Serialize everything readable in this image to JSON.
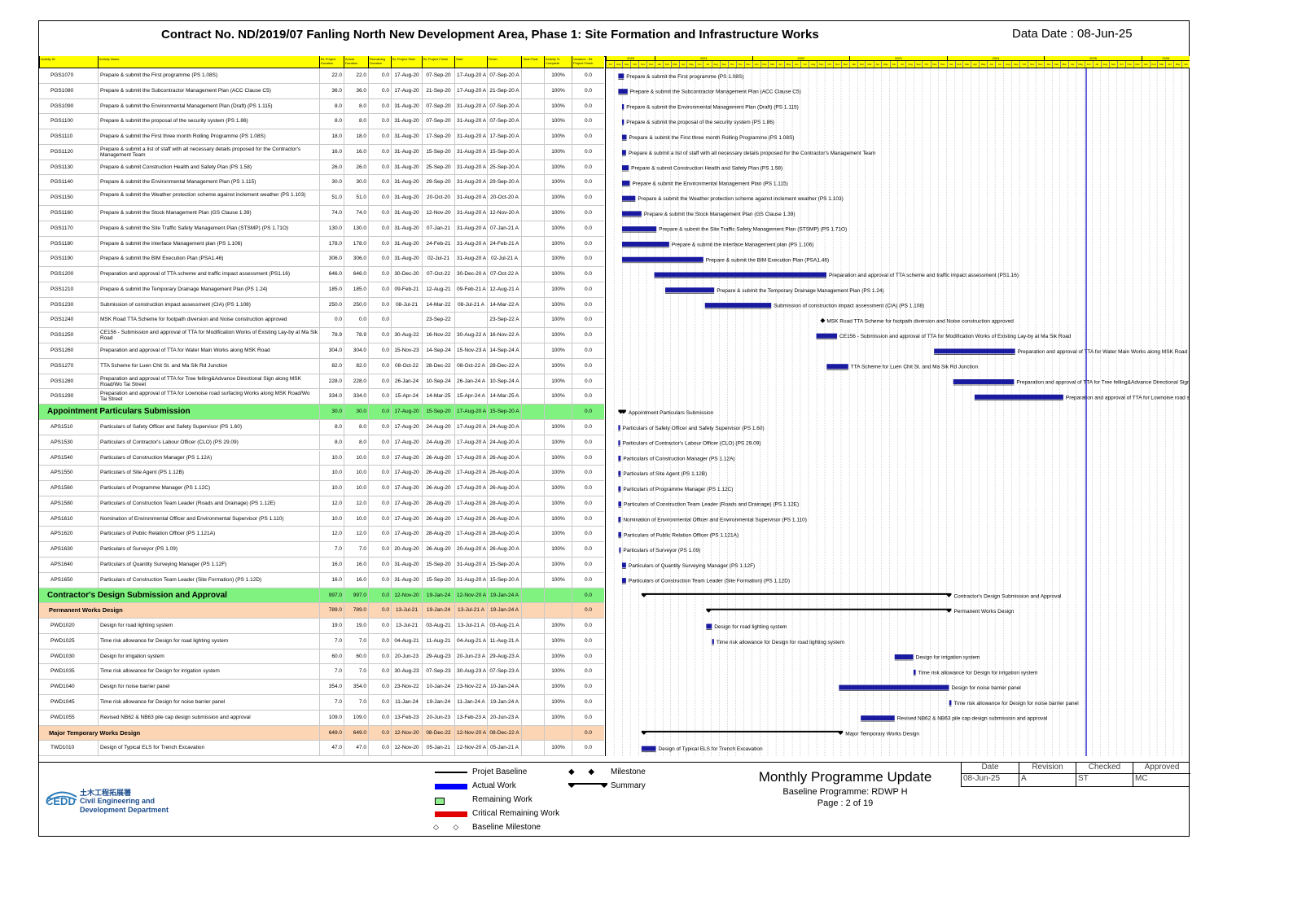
{
  "header": {
    "title": "Contract No. ND/2019/07 Fanling North New Development Area, Phase 1: Site Formation and Infrastructure Works",
    "data_date": "Data Date : 08-Jun-25"
  },
  "columns": [
    "Activity ID",
    "Activity Name",
    "BL Project Duration",
    "Actual Duration",
    "Remaining Duration",
    "BL Project Start",
    "BL Project Finish",
    "Start",
    "Finish",
    "Total Float",
    "Activity % Complete",
    "Variance - BL Project Finish"
  ],
  "timeline": {
    "years": [
      "2020",
      "2021",
      "2022",
      "2023",
      "2024",
      "2025",
      "2026"
    ],
    "months": [
      "Jul",
      "Aug",
      "Sep",
      "Oct",
      "Nov",
      "Dec",
      "Jan",
      "Feb",
      "Mar",
      "Apr",
      "May",
      "Jun"
    ],
    "range_start": "2020-07-01",
    "range_end": "2026-07-01",
    "data_date": "2025-06-08"
  },
  "rows": [
    {
      "type": "task",
      "id": "PGS1070",
      "name": "Prepare & submit the First programme (PS 1.08S)",
      "bl_dur": "22.0",
      "act_dur": "22.0",
      "rem": "0.0",
      "bl_start": "17-Aug-20",
      "bl_finish": "07-Sep-20",
      "start": "17-Aug-20 A",
      "finish": "07-Sep-20 A",
      "tf": "",
      "pct": "100%",
      "var": "0.0"
    },
    {
      "type": "task",
      "id": "PGS1080",
      "name": "Prepare & submit the Subcontractor Management Plan (ACC Clause C5)",
      "bl_dur": "36.0",
      "act_dur": "36.0",
      "rem": "0.0",
      "bl_start": "17-Aug-20",
      "bl_finish": "21-Sep-20",
      "start": "17-Aug-20 A",
      "finish": "21-Sep-20 A",
      "tf": "",
      "pct": "100%",
      "var": "0.0"
    },
    {
      "type": "task",
      "id": "PGS1090",
      "name": "Prepare & submit the Environmental Management Plan (Draft) (PS 1.115)",
      "bl_dur": "8.0",
      "act_dur": "8.0",
      "rem": "0.0",
      "bl_start": "31-Aug-20",
      "bl_finish": "07-Sep-20",
      "start": "31-Aug-20 A",
      "finish": "07-Sep-20 A",
      "tf": "",
      "pct": "100%",
      "var": "0.0"
    },
    {
      "type": "task",
      "id": "PGS1100",
      "name": "Prepare & submit the proposal of the security system (PS 1.86)",
      "bl_dur": "8.0",
      "act_dur": "8.0",
      "rem": "0.0",
      "bl_start": "31-Aug-20",
      "bl_finish": "07-Sep-20",
      "start": "31-Aug-20 A",
      "finish": "07-Sep-20 A",
      "tf": "",
      "pct": "100%",
      "var": "0.0"
    },
    {
      "type": "task",
      "id": "PGS1110",
      "name": "Prepare & submit the First three month Rolling Programme (PS 1.08S)",
      "bl_dur": "18.0",
      "act_dur": "18.0",
      "rem": "0.0",
      "bl_start": "31-Aug-20",
      "bl_finish": "17-Sep-20",
      "start": "31-Aug-20 A",
      "finish": "17-Sep-20 A",
      "tf": "",
      "pct": "100%",
      "var": "0.0"
    },
    {
      "type": "task",
      "id": "PGS1120",
      "name": "Prepare & submit a list of staff with all necessary details proposed for the Contractor's Management Team",
      "bl_dur": "16.0",
      "act_dur": "16.0",
      "rem": "0.0",
      "bl_start": "31-Aug-20",
      "bl_finish": "15-Sep-20",
      "start": "31-Aug-20 A",
      "finish": "15-Sep-20 A",
      "tf": "",
      "pct": "100%",
      "var": "0.0"
    },
    {
      "type": "task",
      "id": "PGS1130",
      "name": "Prepare & submit Construction Health and Safety Plan (PS 1.58)",
      "bl_dur": "26.0",
      "act_dur": "26.0",
      "rem": "0.0",
      "bl_start": "31-Aug-20",
      "bl_finish": "25-Sep-20",
      "start": "31-Aug-20 A",
      "finish": "25-Sep-20 A",
      "tf": "",
      "pct": "100%",
      "var": "0.0"
    },
    {
      "type": "task",
      "id": "PGS1140",
      "name": "Prepare & submit the Environmental Management Plan (PS 1.115)",
      "bl_dur": "30.0",
      "act_dur": "30.0",
      "rem": "0.0",
      "bl_start": "31-Aug-20",
      "bl_finish": "29-Sep-20",
      "start": "31-Aug-20 A",
      "finish": "29-Sep-20 A",
      "tf": "",
      "pct": "100%",
      "var": "0.0"
    },
    {
      "type": "task",
      "id": "PGS1150",
      "name": "Prepare & submit the Weather protection scheme against inclement weather (PS 1.103)",
      "bl_dur": "51.0",
      "act_dur": "51.0",
      "rem": "0.0",
      "bl_start": "31-Aug-20",
      "bl_finish": "20-Oct-20",
      "start": "31-Aug-20 A",
      "finish": "20-Oct-20 A",
      "tf": "",
      "pct": "100%",
      "var": "0.0"
    },
    {
      "type": "task",
      "id": "PGS1160",
      "name": "Prepare & submit the Stock Management Plan (GS Clause 1.39)",
      "bl_dur": "74.0",
      "act_dur": "74.0",
      "rem": "0.0",
      "bl_start": "31-Aug-20",
      "bl_finish": "12-Nov-20",
      "start": "31-Aug-20 A",
      "finish": "12-Nov-20 A",
      "tf": "",
      "pct": "100%",
      "var": "0.0"
    },
    {
      "type": "task",
      "id": "PGS1170",
      "name": "Prepare & submit the Site Traffic Safety Management Plan (STSMP) (PS 1.71O)",
      "bl_dur": "130.0",
      "act_dur": "130.0",
      "rem": "0.0",
      "bl_start": "31-Aug-20",
      "bl_finish": "07-Jan-21",
      "start": "31-Aug-20 A",
      "finish": "07-Jan-21 A",
      "tf": "",
      "pct": "100%",
      "var": "0.0"
    },
    {
      "type": "task",
      "id": "PGS1180",
      "name": "Prepare & submit the interface Management plan (PS 1.106)",
      "bl_dur": "178.0",
      "act_dur": "178.0",
      "rem": "0.0",
      "bl_start": "31-Aug-20",
      "bl_finish": "24-Feb-21",
      "start": "31-Aug-20 A",
      "finish": "24-Feb-21 A",
      "tf": "",
      "pct": "100%",
      "var": "0.0"
    },
    {
      "type": "task",
      "id": "PGS1190",
      "name": "Prepare & submit the BIM Execution Plan (PSA1.46)",
      "bl_dur": "306.0",
      "act_dur": "306.0",
      "rem": "0.0",
      "bl_start": "31-Aug-20",
      "bl_finish": "02-Jul-21",
      "start": "31-Aug-20 A",
      "finish": "02-Jul-21 A",
      "tf": "",
      "pct": "100%",
      "var": "0.0"
    },
    {
      "type": "task",
      "id": "PGS1200",
      "name": "Preparation and approval of TTA scheme and traffic impact assessment (PS1.16)",
      "bl_dur": "646.0",
      "act_dur": "646.0",
      "rem": "0.0",
      "bl_start": "30-Dec-20",
      "bl_finish": "07-Oct-22",
      "start": "30-Dec-20 A",
      "finish": "07-Oct-22 A",
      "tf": "",
      "pct": "100%",
      "var": "0.0"
    },
    {
      "type": "task",
      "id": "PGS1210",
      "name": "Prepare & submit the Temporary Drainage Management Plan (PS 1.24)",
      "bl_dur": "185.0",
      "act_dur": "185.0",
      "rem": "0.0",
      "bl_start": "09-Feb-21",
      "bl_finish": "12-Aug-21",
      "start": "09-Feb-21 A",
      "finish": "12-Aug-21 A",
      "tf": "",
      "pct": "100%",
      "var": "0.0"
    },
    {
      "type": "task",
      "id": "PGS1230",
      "name": "Submission of construction impact assessment (CIA) (PS 1.108)",
      "bl_dur": "250.0",
      "act_dur": "250.0",
      "rem": "0.0",
      "bl_start": "08-Jul-21",
      "bl_finish": "14-Mar-22",
      "start": "08-Jul-21 A",
      "finish": "14-Mar-22 A",
      "tf": "",
      "pct": "100%",
      "var": "0.0"
    },
    {
      "type": "milestone",
      "id": "PGS1240",
      "name": "MSK Road TTA Scheme for footpath diversion and Noise construction approved",
      "bl_dur": "0.0",
      "act_dur": "0.0",
      "rem": "0.0",
      "bl_start": "",
      "bl_finish": "23-Sep-22",
      "start": "",
      "finish": "23-Sep-22 A",
      "tf": "",
      "pct": "100%",
      "var": "0.0"
    },
    {
      "type": "task",
      "id": "PGS1250",
      "name": "CE156 - Submission and approval of TTA for Modification Works of Existing Lay-by at Ma Sik Road",
      "bl_dur": "78.9",
      "act_dur": "78.9",
      "rem": "0.0",
      "bl_start": "30-Aug-22",
      "bl_finish": "16-Nov-22",
      "start": "30-Aug-22 A",
      "finish": "16-Nov-22 A",
      "tf": "",
      "pct": "100%",
      "var": "0.0"
    },
    {
      "type": "task",
      "id": "PGS1260",
      "name": "Preparation and approval of TTA for Water Main Works along MSK Road",
      "bl_dur": "304.0",
      "act_dur": "304.0",
      "rem": "0.0",
      "bl_start": "15-Nov-23",
      "bl_finish": "14-Sep-24",
      "start": "15-Nov-23 A",
      "finish": "14-Sep-24 A",
      "tf": "",
      "pct": "100%",
      "var": "0.0"
    },
    {
      "type": "task",
      "id": "PGS1270",
      "name": "TTA Scheme for Luen Chit St. and Ma Sik Rd Junction",
      "bl_dur": "82.0",
      "act_dur": "82.0",
      "rem": "0.0",
      "bl_start": "08-Oct-22",
      "bl_finish": "28-Dec-22",
      "start": "08-Oct-22 A",
      "finish": "28-Dec-22 A",
      "tf": "",
      "pct": "100%",
      "var": "0.0"
    },
    {
      "type": "task",
      "id": "PGS1280",
      "name": "Preparation and approval of TTA for Tree felling&Advance Directional Sign along MSK Road/Wo Tai Street",
      "bl_dur": "228.0",
      "act_dur": "228.0",
      "rem": "0.0",
      "bl_start": "26-Jan-24",
      "bl_finish": "10-Sep-24",
      "start": "26-Jan-24 A",
      "finish": "10-Sep-24 A",
      "tf": "",
      "pct": "100%",
      "var": "0.0"
    },
    {
      "type": "task",
      "id": "PGS1290",
      "name": "Preparation and approval of TTA for Lownoise road surfacing Works along MSK Road/Wo Tai Street",
      "bl_dur": "334.0",
      "act_dur": "334.0",
      "rem": "0.0",
      "bl_start": "15-Apr-24",
      "bl_finish": "14-Mar-25",
      "start": "15-Apr-24 A",
      "finish": "14-Mar-25 A",
      "tf": "",
      "pct": "100%",
      "var": "0.0"
    },
    {
      "type": "wbs1",
      "id": "",
      "name": "Appointment Particulars Submission",
      "bl_dur": "30.0",
      "act_dur": "30.0",
      "rem": "0.0",
      "bl_start": "17-Aug-20",
      "bl_finish": "15-Sep-20",
      "start": "17-Aug-20 A",
      "finish": "15-Sep-20 A",
      "tf": "",
      "pct": "",
      "var": "0.0"
    },
    {
      "type": "task",
      "id": "APS1510",
      "name": "Particulars of Safety Officer and Safety Supervisor (PS 1.60)",
      "bl_dur": "8.0",
      "act_dur": "8.0",
      "rem": "0.0",
      "bl_start": "17-Aug-20",
      "bl_finish": "24-Aug-20",
      "start": "17-Aug-20 A",
      "finish": "24-Aug-20 A",
      "tf": "",
      "pct": "100%",
      "var": "0.0"
    },
    {
      "type": "task",
      "id": "APS1530",
      "name": "Particulars of Contractor's Labour Officer (CLO) (PS 29.09)",
      "bl_dur": "8.0",
      "act_dur": "8.0",
      "rem": "0.0",
      "bl_start": "17-Aug-20",
      "bl_finish": "24-Aug-20",
      "start": "17-Aug-20 A",
      "finish": "24-Aug-20 A",
      "tf": "",
      "pct": "100%",
      "var": "0.0"
    },
    {
      "type": "task",
      "id": "APS1540",
      "name": "Particulars of Construction Manager (PS 1.12A)",
      "bl_dur": "10.0",
      "act_dur": "10.0",
      "rem": "0.0",
      "bl_start": "17-Aug-20",
      "bl_finish": "26-Aug-20",
      "start": "17-Aug-20 A",
      "finish": "26-Aug-20 A",
      "tf": "",
      "pct": "100%",
      "var": "0.0"
    },
    {
      "type": "task",
      "id": "APS1550",
      "name": "Particulars of Site Agent (PS 1.12B)",
      "bl_dur": "10.0",
      "act_dur": "10.0",
      "rem": "0.0",
      "bl_start": "17-Aug-20",
      "bl_finish": "26-Aug-20",
      "start": "17-Aug-20 A",
      "finish": "26-Aug-20 A",
      "tf": "",
      "pct": "100%",
      "var": "0.0"
    },
    {
      "type": "task",
      "id": "APS1560",
      "name": "Particulars of Programme Manager (PS 1.12C)",
      "bl_dur": "10.0",
      "act_dur": "10.0",
      "rem": "0.0",
      "bl_start": "17-Aug-20",
      "bl_finish": "26-Aug-20",
      "start": "17-Aug-20 A",
      "finish": "26-Aug-20 A",
      "tf": "",
      "pct": "100%",
      "var": "0.0"
    },
    {
      "type": "task",
      "id": "APS1580",
      "name": "Particulars of Construction Team Leader (Roads and Drainage) (PS 1.12E)",
      "bl_dur": "12.0",
      "act_dur": "12.0",
      "rem": "0.0",
      "bl_start": "17-Aug-20",
      "bl_finish": "28-Aug-20",
      "start": "17-Aug-20 A",
      "finish": "28-Aug-20 A",
      "tf": "",
      "pct": "100%",
      "var": "0.0"
    },
    {
      "type": "task",
      "id": "APS1610",
      "name": "Nomination of Environmental Officer and Environmental Supervisor (PS 1.110)",
      "bl_dur": "10.0",
      "act_dur": "10.0",
      "rem": "0.0",
      "bl_start": "17-Aug-20",
      "bl_finish": "26-Aug-20",
      "start": "17-Aug-20 A",
      "finish": "26-Aug-20 A",
      "tf": "",
      "pct": "100%",
      "var": "0.0"
    },
    {
      "type": "task",
      "id": "APS1620",
      "name": "Particulars of Public Relation Officer (PS 1.121A)",
      "bl_dur": "12.0",
      "act_dur": "12.0",
      "rem": "0.0",
      "bl_start": "17-Aug-20",
      "bl_finish": "28-Aug-20",
      "start": "17-Aug-20 A",
      "finish": "28-Aug-20 A",
      "tf": "",
      "pct": "100%",
      "var": "0.0"
    },
    {
      "type": "task",
      "id": "APS1630",
      "name": "Particulars of Surveyor (PS 1.09)",
      "bl_dur": "7.0",
      "act_dur": "7.0",
      "rem": "0.0",
      "bl_start": "20-Aug-20",
      "bl_finish": "26-Aug-20",
      "start": "20-Aug-20 A",
      "finish": "26-Aug-20 A",
      "tf": "",
      "pct": "100%",
      "var": "0.0"
    },
    {
      "type": "task",
      "id": "APS1640",
      "name": "Particulars of Quantity Surveying Manager (PS 1.12F)",
      "bl_dur": "16.0",
      "act_dur": "16.0",
      "rem": "0.0",
      "bl_start": "31-Aug-20",
      "bl_finish": "15-Sep-20",
      "start": "31-Aug-20 A",
      "finish": "15-Sep-20 A",
      "tf": "",
      "pct": "100%",
      "var": "0.0"
    },
    {
      "type": "task",
      "id": "APS1650",
      "name": "Particulars of Construction Team Leader (Site Formation) (PS 1.12D)",
      "bl_dur": "16.0",
      "act_dur": "16.0",
      "rem": "0.0",
      "bl_start": "31-Aug-20",
      "bl_finish": "15-Sep-20",
      "start": "31-Aug-20 A",
      "finish": "15-Sep-20 A",
      "tf": "",
      "pct": "100%",
      "var": "0.0"
    },
    {
      "type": "wbs1",
      "id": "",
      "name": "Contractor's Design Submission and Approval",
      "bl_dur": "997.0",
      "act_dur": "997.0",
      "rem": "0.0",
      "bl_start": "12-Nov-20",
      "bl_finish": "19-Jan-24",
      "start": "12-Nov-20 A",
      "finish": "19-Jan-24 A",
      "tf": "",
      "pct": "",
      "var": "0.0"
    },
    {
      "type": "wbs2",
      "id": "",
      "name": "Permanent Works Design",
      "bl_dur": "789.0",
      "act_dur": "789.0",
      "rem": "0.0",
      "bl_start": "13-Jul-21",
      "bl_finish": "19-Jan-24",
      "start": "13-Jul-21 A",
      "finish": "19-Jan-24 A",
      "tf": "",
      "pct": "",
      "var": "0.0"
    },
    {
      "type": "task",
      "id": "PWD1020",
      "name": "Design for road lighting system",
      "bl_dur": "19.0",
      "act_dur": "19.0",
      "rem": "0.0",
      "bl_start": "13-Jul-21",
      "bl_finish": "03-Aug-21",
      "start": "13-Jul-21 A",
      "finish": "03-Aug-21 A",
      "tf": "",
      "pct": "100%",
      "var": "0.0"
    },
    {
      "type": "task",
      "id": "PWD1025",
      "name": "Time risk allowance for Design for road lighting system",
      "bl_dur": "7.0",
      "act_dur": "7.0",
      "rem": "0.0",
      "bl_start": "04-Aug-21",
      "bl_finish": "11-Aug-21",
      "start": "04-Aug-21 A",
      "finish": "11-Aug-21 A",
      "tf": "",
      "pct": "100%",
      "var": "0.0"
    },
    {
      "type": "task",
      "id": "PWD1030",
      "name": "Design for irrigation system",
      "bl_dur": "60.0",
      "act_dur": "60.0",
      "rem": "0.0",
      "bl_start": "20-Jun-23",
      "bl_finish": "29-Aug-23",
      "start": "20-Jun-23 A",
      "finish": "29-Aug-23 A",
      "tf": "",
      "pct": "100%",
      "var": "0.0"
    },
    {
      "type": "task",
      "id": "PWD1035",
      "name": "Time risk allowance for Design for irrigation system",
      "bl_dur": "7.0",
      "act_dur": "7.0",
      "rem": "0.0",
      "bl_start": "30-Aug-23",
      "bl_finish": "07-Sep-23",
      "start": "30-Aug-23 A",
      "finish": "07-Sep-23 A",
      "tf": "",
      "pct": "100%",
      "var": "0.0"
    },
    {
      "type": "task",
      "id": "PWD1040",
      "name": "Design for noise barrier panel",
      "bl_dur": "354.0",
      "act_dur": "354.0",
      "rem": "0.0",
      "bl_start": "23-Nov-22",
      "bl_finish": "10-Jan-24",
      "start": "23-Nov-22 A",
      "finish": "10-Jan-24 A",
      "tf": "",
      "pct": "100%",
      "var": "0.0"
    },
    {
      "type": "task",
      "id": "PWD1045",
      "name": "Time risk allowance for Design for noise barrier panel",
      "bl_dur": "7.0",
      "act_dur": "7.0",
      "rem": "0.0",
      "bl_start": "11-Jan-24",
      "bl_finish": "19-Jan-24",
      "start": "11-Jan-24 A",
      "finish": "19-Jan-24 A",
      "tf": "",
      "pct": "100%",
      "var": "0.0"
    },
    {
      "type": "task",
      "id": "PWD1055",
      "name": "Revised NB62 & NB63 pile cap design submission and approval",
      "bl_dur": "109.0",
      "act_dur": "109.0",
      "rem": "0.0",
      "bl_start": "13-Feb-23",
      "bl_finish": "20-Jun-23",
      "start": "13-Feb-23 A",
      "finish": "20-Jun-23 A",
      "tf": "",
      "pct": "100%",
      "var": "0.0"
    },
    {
      "type": "wbs2",
      "id": "",
      "name": "Major Temporary Works Design",
      "bl_dur": "649.0",
      "act_dur": "649.0",
      "rem": "0.0",
      "bl_start": "12-Nov-20",
      "bl_finish": "08-Dec-22",
      "start": "12-Nov-20 A",
      "finish": "08-Dec-22 A",
      "tf": "",
      "pct": "",
      "var": "0.0"
    },
    {
      "type": "task",
      "id": "TWD1010",
      "name": "Design of Typical ELS for Trench Excavation",
      "bl_dur": "47.0",
      "act_dur": "47.0",
      "rem": "0.0",
      "bl_start": "12-Nov-20",
      "bl_finish": "05-Jan-21",
      "start": "12-Nov-20 A",
      "finish": "05-Jan-21 A",
      "tf": "",
      "pct": "100%",
      "var": "0.0"
    }
  ],
  "legend": {
    "baseline": "Projet Baseline",
    "actual": "Actual Work",
    "remaining": "Remaining Work",
    "critical": "Critical Remaining Work",
    "baseline_milestone": "Baseline Milestone",
    "milestone": "Milestone",
    "summary": "Summary"
  },
  "footer": {
    "logo_text": "CEDD",
    "dept_chinese": "土木工程拓展署",
    "dept_line1": "Civil Engineering and",
    "dept_line2": "Development Department",
    "report_title": "Monthly Programme Update",
    "baseline": "Baseline Programme: RDWP H",
    "page": "Page : 2 of 19",
    "sign_headers": [
      "Date",
      "Revision",
      "Checked",
      "Approved"
    ],
    "sign_values": [
      "08-Jun-25",
      "A",
      "ST",
      "MC"
    ]
  },
  "colors": {
    "header_yellow": "#ffff00",
    "wbs1_green": "#7ff27f",
    "wbs2_orange": "#fcd5b4",
    "actual_bar": "#1a1aa0",
    "data_date_line": "#3333cc",
    "critical": "#e00000",
    "remaining": "#90ee90"
  }
}
